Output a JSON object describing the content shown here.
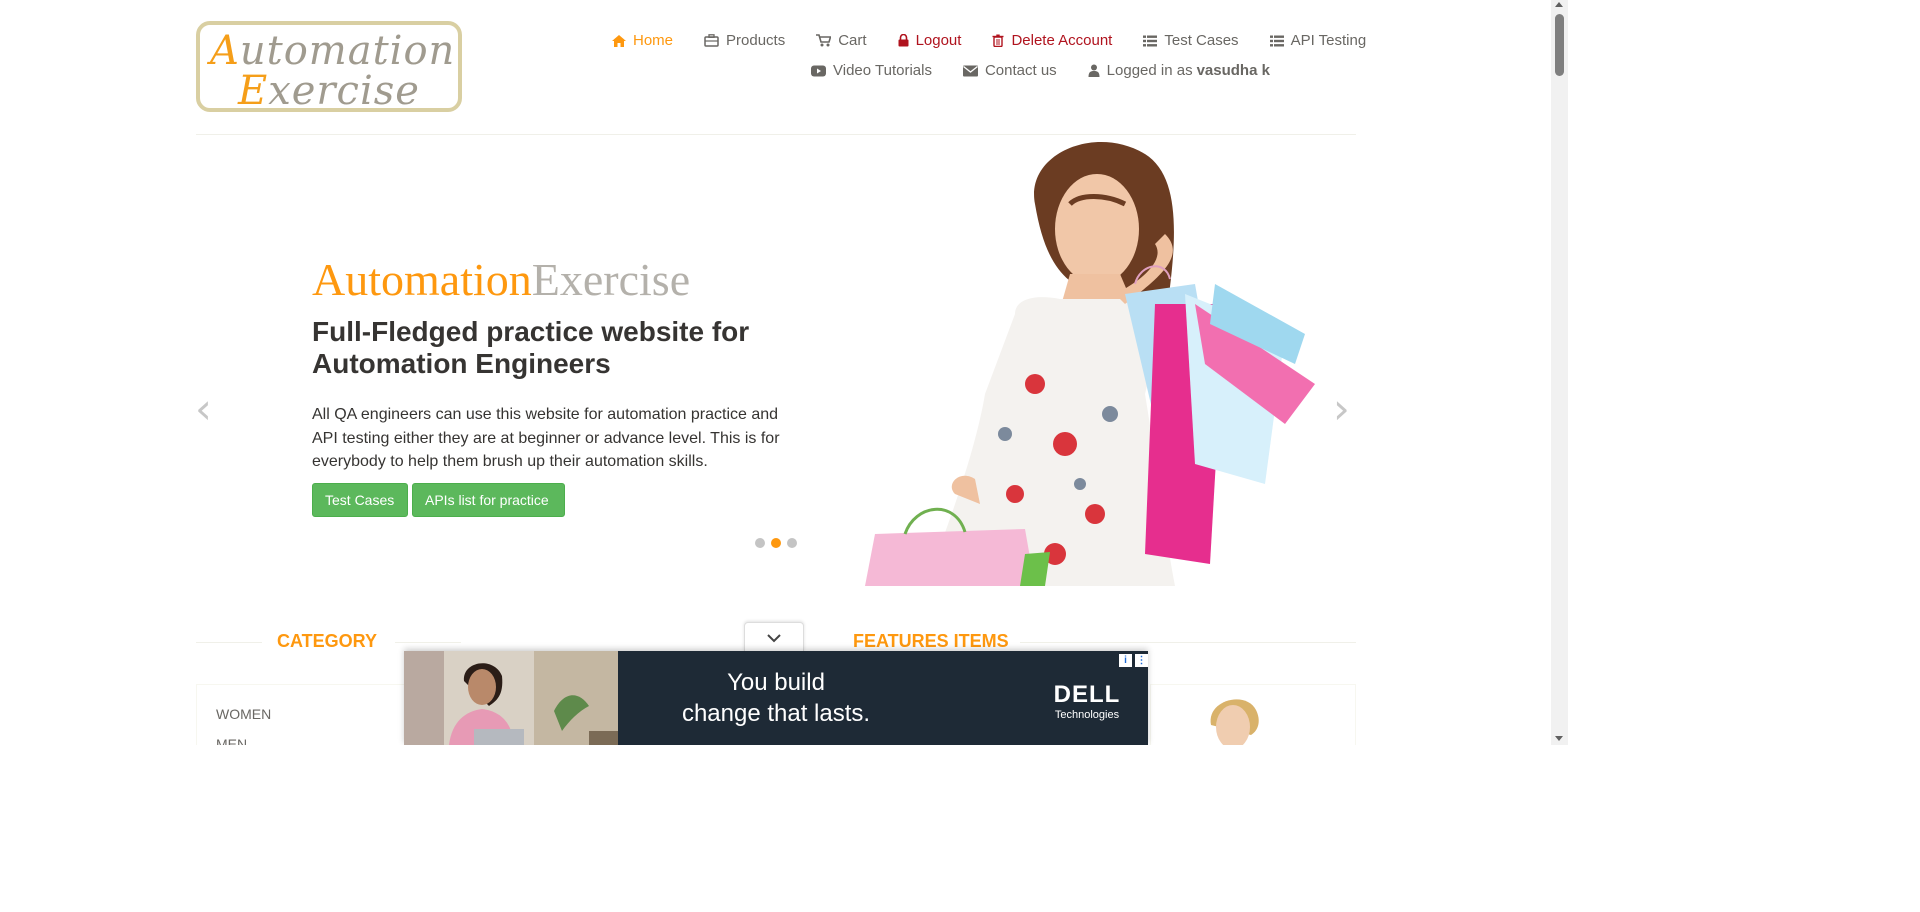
{
  "logo": {
    "line1_cap": "A",
    "line1_rest": "utomation",
    "line2_cap": "E",
    "line2_rest": "xercise"
  },
  "nav": {
    "home": "Home",
    "products": "Products",
    "cart": "Cart",
    "logout": "Logout",
    "delete_account": "Delete Account",
    "test_cases": "Test Cases",
    "api_testing": "API Testing",
    "video_tutorials": "Video Tutorials",
    "contact_us": "Contact us",
    "logged_in_prefix": "Logged in as",
    "logged_in_user": "vasudha k"
  },
  "hero": {
    "brand_a": "Automation",
    "brand_b": "Exercise",
    "heading": "Full-Fledged practice website for Automation Engineers",
    "text": "All QA engineers can use this website for automation practice and API testing either they are at beginner or advance level. This is for everybody to help them brush up their automation skills.",
    "btn_test_cases": "Test Cases",
    "btn_apis": "APIs list for practice",
    "active_slide": 2,
    "slide_count": 3
  },
  "sections": {
    "category_title": "CATEGORY",
    "features_title": "FEATURES ITEMS",
    "categories": [
      "WOMEN",
      "MEN"
    ]
  },
  "ad": {
    "headline_line1": "You build",
    "headline_line2": "change that lasts.",
    "brand": "DELL",
    "brand_sub": "Technologies"
  },
  "colors": {
    "accent": "#fe980f",
    "danger": "#b0131e",
    "button_green": "#5cb85c",
    "ad_bg": "#1e2a36"
  }
}
